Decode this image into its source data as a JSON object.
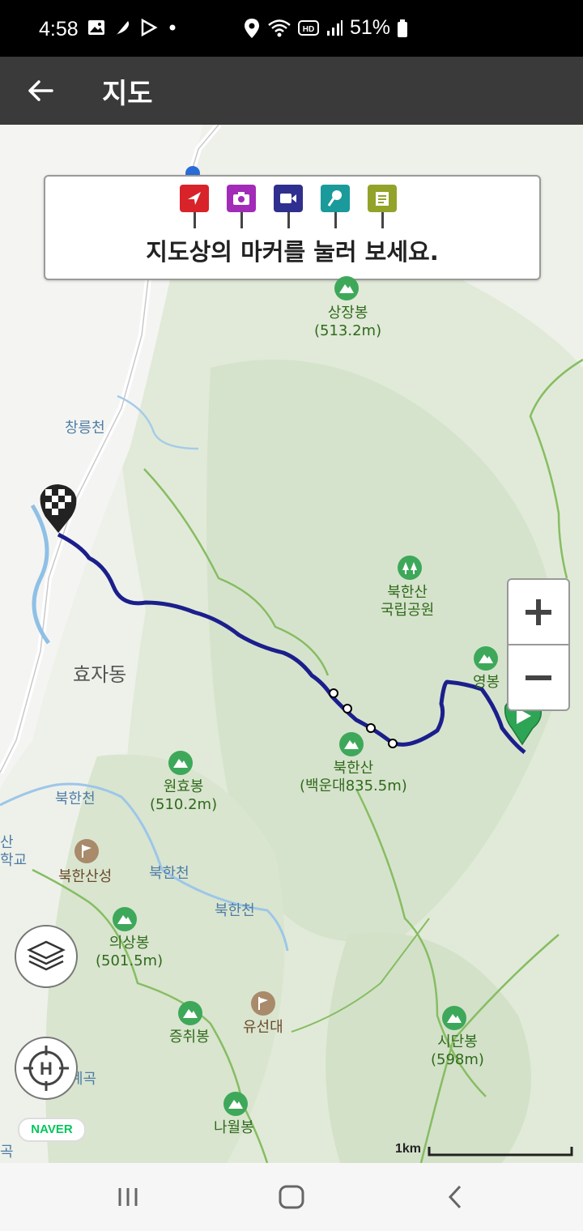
{
  "status": {
    "time": "4:58",
    "battery": "51%"
  },
  "appbar": {
    "title": "지도"
  },
  "banner": {
    "message": "지도상의 마커를 눌러 보세요."
  },
  "markers": [
    {
      "name": "direction-pin",
      "color": "#d8232a"
    },
    {
      "name": "photo-pin",
      "color": "#a22bb8"
    },
    {
      "name": "video-pin",
      "color": "#2f2f8f"
    },
    {
      "name": "voice-pin",
      "color": "#1a9a9a"
    },
    {
      "name": "memo-pin",
      "color": "#93a32a"
    }
  ],
  "labels": {
    "sangjangbong": "상장봉",
    "sangjangbong_h": "(513.2m)",
    "changneungcheon": "창릉천",
    "bukhansan_park1": "북한산",
    "bukhansan_park2": "국립공원",
    "hyojadong": "효자동",
    "yeongbong": "영봉",
    "bukhansan": "북한산",
    "baegundae": "(백운대835.5m)",
    "wonhyobong": "원효봉",
    "wonhyobong_h": "(510.2m)",
    "bukhancheon1": "북한천",
    "bukhancheon2": "북한천",
    "bukhancheon3": "북한천",
    "bukhansanseong": "북한산성",
    "uisangbong": "의상봉",
    "uisangbong_h": "(501.5m)",
    "jeungchwibong": "증취봉",
    "yuseondae": "유선대",
    "sidanbong": "시단봉",
    "sidanbong_h": "(598m)",
    "nawolbong": "나월봉",
    "gyegok": "계곡",
    "left_san": "산",
    "left_hakgyo": "학교",
    "left_gok": "곡"
  },
  "map": {
    "attribution": "NAVER",
    "scale": "1km",
    "route_color": "#1b1f8c"
  }
}
